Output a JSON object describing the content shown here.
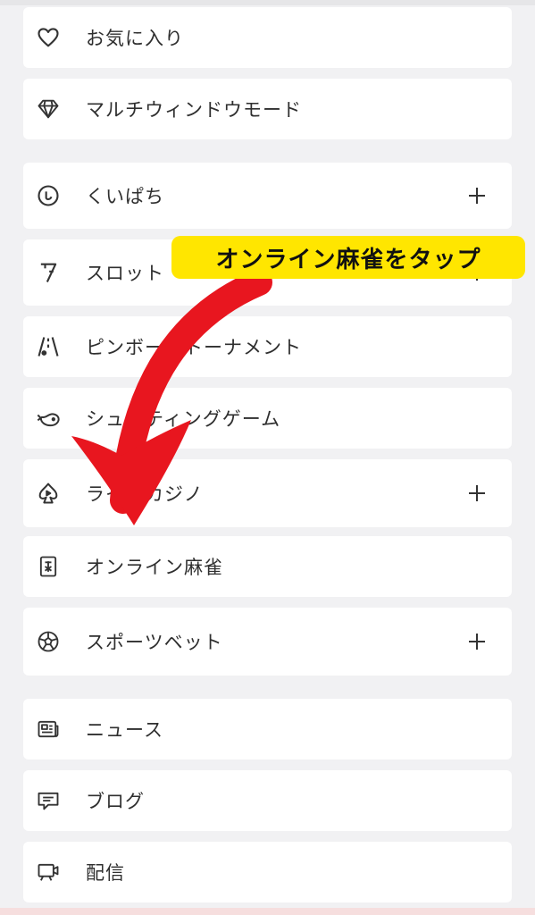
{
  "menu": {
    "favorites": "お気に入り",
    "multiwindow": "マルチウィンドウモード",
    "kuipachi": "くいぱち",
    "slot": "スロット",
    "pinball": "ピンボールトーナメント",
    "shooting": "シューティングゲーム",
    "live_casino": "ライブカジノ",
    "online_mahjong": "オンライン麻雀",
    "sports_bet": "スポーツベット",
    "news": "ニュース",
    "blog": "ブログ",
    "stream": "配信"
  },
  "annotation": {
    "callout_text": "オンライン麻雀をタップ",
    "callout_color": "#ffe600",
    "arrow_color": "#e8161f"
  },
  "icons": {
    "favorites": "heart-icon",
    "multiwindow": "diamond-icon",
    "kuipachi": "smile-circle-icon",
    "slot": "seven-icon",
    "pinball": "pinball-lane-icon",
    "shooting": "whale-icon",
    "live_casino": "spade-play-icon",
    "online_mahjong": "mahjong-tile-icon",
    "sports_bet": "soccer-ball-icon",
    "news": "newspaper-icon",
    "blog": "comment-icon",
    "stream": "video-screen-icon",
    "expand": "plus-icon"
  }
}
